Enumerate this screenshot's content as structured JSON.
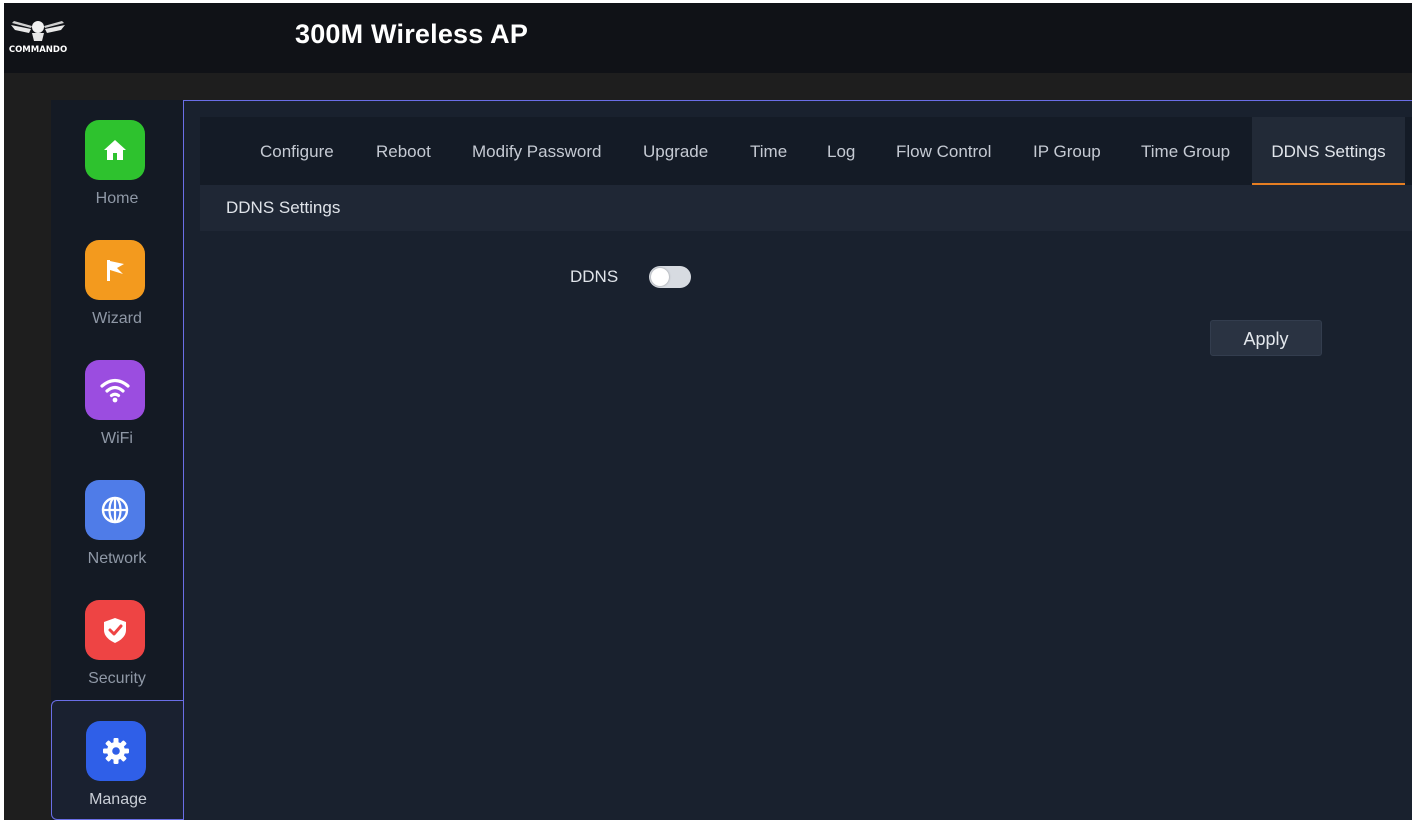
{
  "header": {
    "app_title": "300M Wireless AP",
    "logo_text": "COMMANDO"
  },
  "sidebar": {
    "items": [
      {
        "label": "Home",
        "icon": "home-icon",
        "color": "#2ec22e"
      },
      {
        "label": "Wizard",
        "icon": "flag-icon",
        "color": "#f39a1e"
      },
      {
        "label": "WiFi",
        "icon": "wifi-icon",
        "color": "#9b4de0"
      },
      {
        "label": "Network",
        "icon": "globe-icon",
        "color": "#4f7ce8"
      },
      {
        "label": "Security",
        "icon": "shield-icon",
        "color": "#ee4444"
      },
      {
        "label": "Manage",
        "icon": "gear-icon",
        "color": "#2f5fe8",
        "active": true
      }
    ]
  },
  "tabs": [
    {
      "label": "Configure"
    },
    {
      "label": "Reboot"
    },
    {
      "label": "Modify Password"
    },
    {
      "label": "Upgrade"
    },
    {
      "label": "Time"
    },
    {
      "label": "Log"
    },
    {
      "label": "Flow Control"
    },
    {
      "label": "IP Group"
    },
    {
      "label": "Time Group"
    },
    {
      "label": "DDNS Settings",
      "active": true
    }
  ],
  "section": {
    "title": "DDNS Settings"
  },
  "form": {
    "ddns_label": "DDNS",
    "ddns_enabled": false,
    "apply_label": "Apply"
  },
  "colors": {
    "accent_border": "#6a6ee6",
    "active_tab_underline": "#e67e22"
  }
}
